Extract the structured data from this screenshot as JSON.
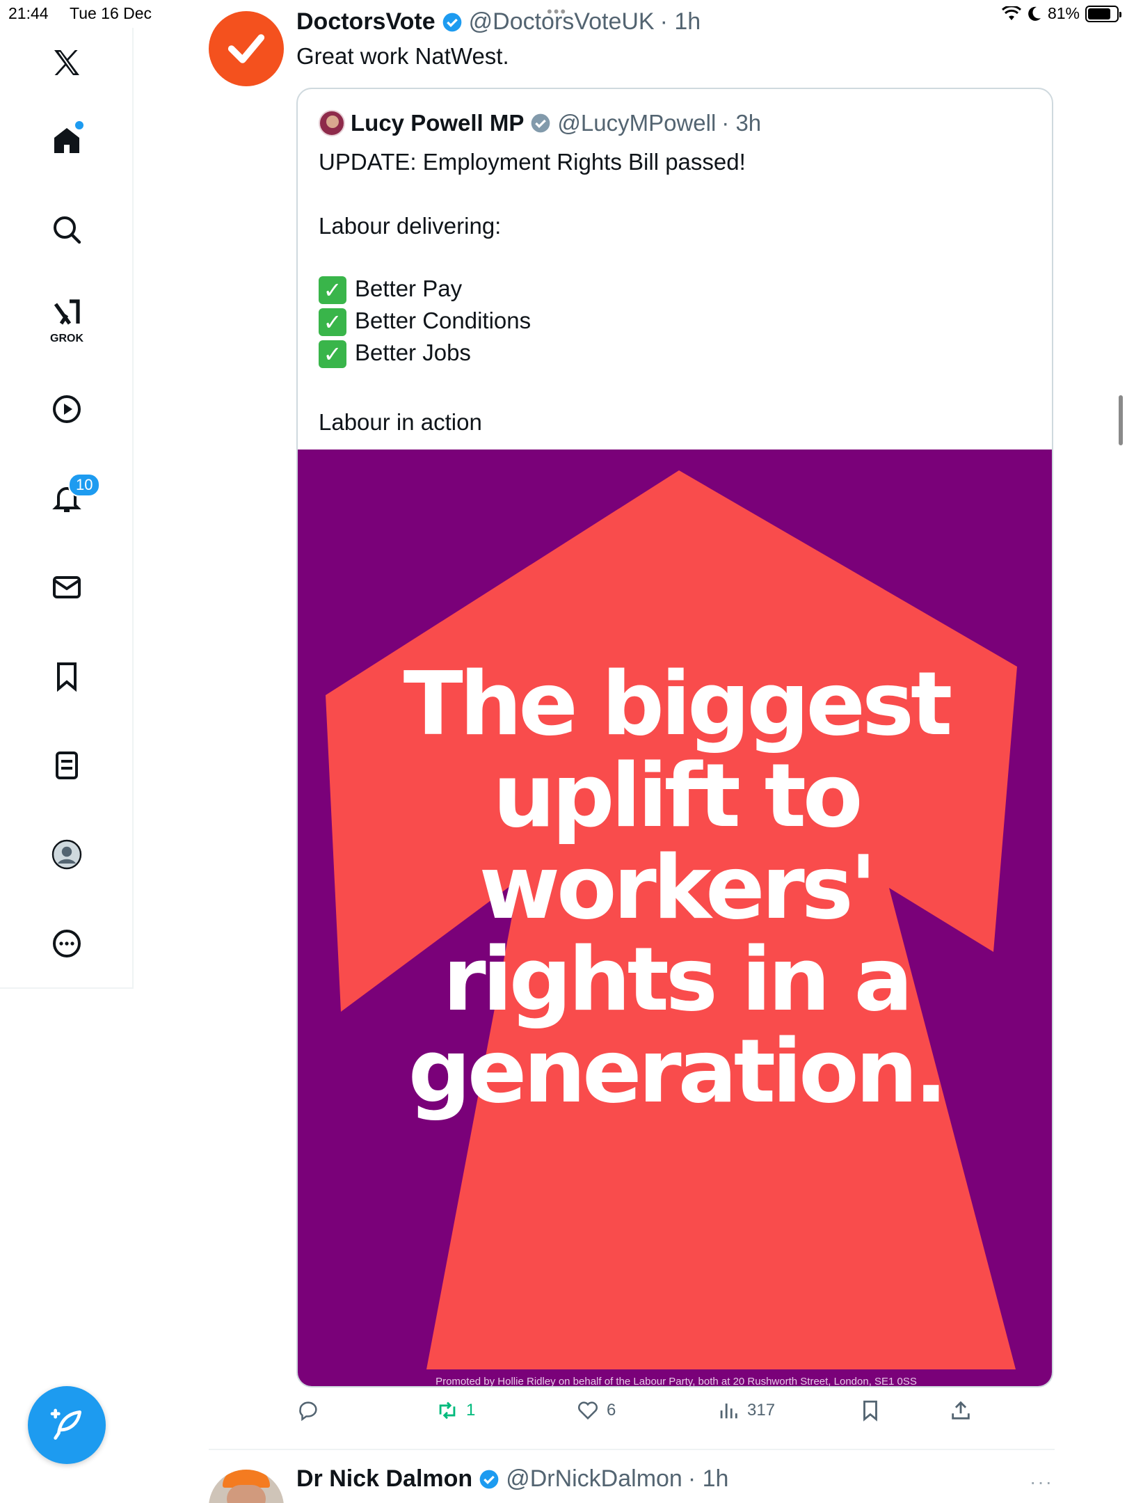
{
  "status_bar": {
    "time": "21:44",
    "date": "Tue 16 Dec",
    "battery": "81%",
    "battery_level": 0.81
  },
  "sidebar": {
    "notifications_badge": "10",
    "grok_label": "GROK",
    "icons": [
      "x-logo-icon",
      "home-icon",
      "search-icon",
      "grok-icon",
      "video-icon",
      "notifications-icon",
      "messages-icon",
      "bookmarks-icon",
      "lists-icon",
      "profile-icon",
      "more-icon"
    ]
  },
  "main_tweet": {
    "name": "DoctorsVote",
    "handle": "@DoctorsVoteUK",
    "time": "· 1h",
    "text": "Great work NatWest.",
    "avatar_color": "#f4511e"
  },
  "quote_tweet": {
    "name": "Lucy Powell MP",
    "handle": "@LucyMPowell",
    "time": "· 3h",
    "line1": "UPDATE: Employment Rights Bill passed!",
    "line2": "Labour delivering:",
    "checks": [
      "Better Pay",
      "Better Conditions",
      "Better Jobs"
    ],
    "line3": "Labour in action"
  },
  "poster": {
    "lines": [
      "The biggest",
      "uplift to",
      "workers'",
      "rights in a",
      "generation."
    ],
    "footer": "Promoted by Hollie Ridley on behalf of the Labour Party, both at 20 Rushworth Street, London, SE1 0SS",
    "background": "#7a0179",
    "arrow_color": "#f94c4c"
  },
  "actions": {
    "retweets": "1",
    "likes": "6",
    "views": "317"
  },
  "next_tweet": {
    "name": "Dr Nick Dalmon",
    "handle": "@DrNickDalmon",
    "time": "· 1h",
    "more": "···"
  },
  "colors": {
    "accent": "#1d9bf0",
    "retweet": "#00ba7c"
  }
}
